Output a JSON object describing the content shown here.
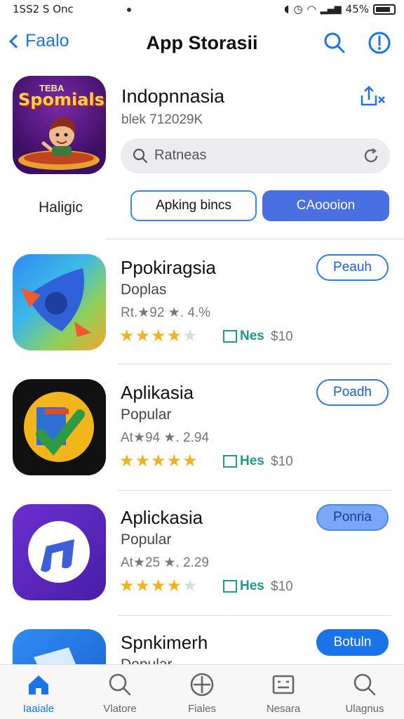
{
  "status_bar": {
    "time_text": "1SS2 S Onc",
    "battery_text": "45%"
  },
  "nav": {
    "back_label": "Faalo",
    "title": "App Storasii"
  },
  "featured": {
    "logo_top": "TEBA",
    "logo_text": "Spomials",
    "name": "Indopnnasia",
    "subtitle": "blek 712029K"
  },
  "search": {
    "placeholder": "Ratneas"
  },
  "filters": {
    "label": "Haligic",
    "chip_1": "Apking bincs",
    "chip_2": "CAoooion"
  },
  "apps": [
    {
      "name": "Ppokiragsia",
      "category": "Doplas",
      "meta": "Rt.★92 ★. 4.%",
      "stars": 4,
      "badge": "Nes",
      "price": "$10",
      "button": "Peauh",
      "button_style": "outline"
    },
    {
      "name": "Aplikasia",
      "category": "Popular",
      "meta": "At★94 ★. 2.94",
      "stars": 4.5,
      "badge": "Hes",
      "price": "$10",
      "button": "Poadh",
      "button_style": "outline"
    },
    {
      "name": "Aplickasia",
      "category": "Popular",
      "meta": "At★25 ★. 2.29",
      "stars": 4,
      "badge": "Hes",
      "price": "$10",
      "button": "Ponria",
      "button_style": "light"
    },
    {
      "name": "Spnkimerh",
      "category": "Dopular",
      "button": "Botuln",
      "button_style": "solid"
    }
  ],
  "tabs": [
    {
      "label": "Iaaiale",
      "icon": "home-icon",
      "active": true
    },
    {
      "label": "Vlatore",
      "icon": "search-icon",
      "active": false
    },
    {
      "label": "Fiales",
      "icon": "plus-circle-icon",
      "active": false
    },
    {
      "label": "Nesara",
      "icon": "list-icon",
      "active": false
    },
    {
      "label": "Ulagnus",
      "icon": "search-icon",
      "active": false
    }
  ],
  "colors": {
    "accent": "#1a73e8",
    "star": "#f5b120",
    "badge": "#1f9a8a"
  }
}
